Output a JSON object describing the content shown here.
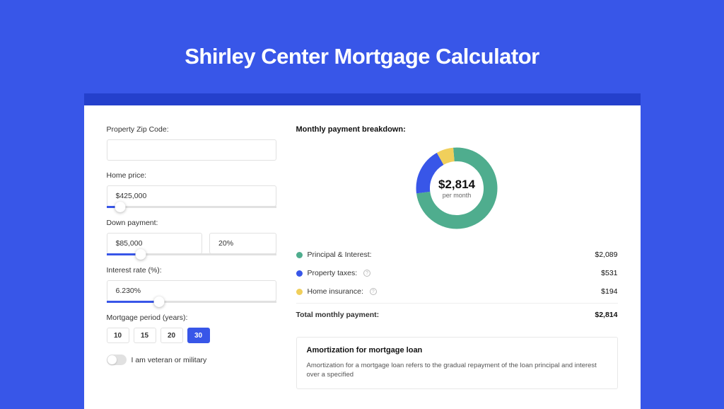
{
  "title": "Shirley Center Mortgage Calculator",
  "form": {
    "zip_label": "Property Zip Code:",
    "zip_value": "",
    "home_price_label": "Home price:",
    "home_price_value": "$425,000",
    "home_price_slider_pct": 8,
    "down_payment_label": "Down payment:",
    "down_payment_value": "$85,000",
    "down_payment_pct_value": "20%",
    "down_payment_slider_pct": 20,
    "interest_label": "Interest rate (%):",
    "interest_value": "6.230%",
    "interest_slider_pct": 31,
    "period_label": "Mortgage period (years):",
    "periods": [
      "10",
      "15",
      "20",
      "30"
    ],
    "period_selected": "30",
    "veteran_label": "I am veteran or military"
  },
  "breakdown": {
    "title": "Monthly payment breakdown:",
    "center_amount": "$2,814",
    "center_sub": "per month",
    "items": [
      {
        "label": "Principal & Interest:",
        "value": "$2,089",
        "color": "#4fad8e",
        "pct": 74.2,
        "info": false
      },
      {
        "label": "Property taxes:",
        "value": "$531",
        "color": "#3856e8",
        "pct": 18.9,
        "info": true
      },
      {
        "label": "Home insurance:",
        "value": "$194",
        "color": "#f0cf5b",
        "pct": 6.9,
        "info": true
      }
    ],
    "total_label": "Total monthly payment:",
    "total_value": "$2,814"
  },
  "amort": {
    "title": "Amortization for mortgage loan",
    "text": "Amortization for a mortgage loan refers to the gradual repayment of the loan principal and interest over a specified"
  },
  "chart_data": {
    "type": "pie",
    "title": "Monthly payment breakdown",
    "categories": [
      "Principal & Interest",
      "Property taxes",
      "Home insurance"
    ],
    "values": [
      2089,
      531,
      194
    ],
    "colors": [
      "#4fad8e",
      "#3856e8",
      "#f0cf5b"
    ],
    "total": 2814
  }
}
